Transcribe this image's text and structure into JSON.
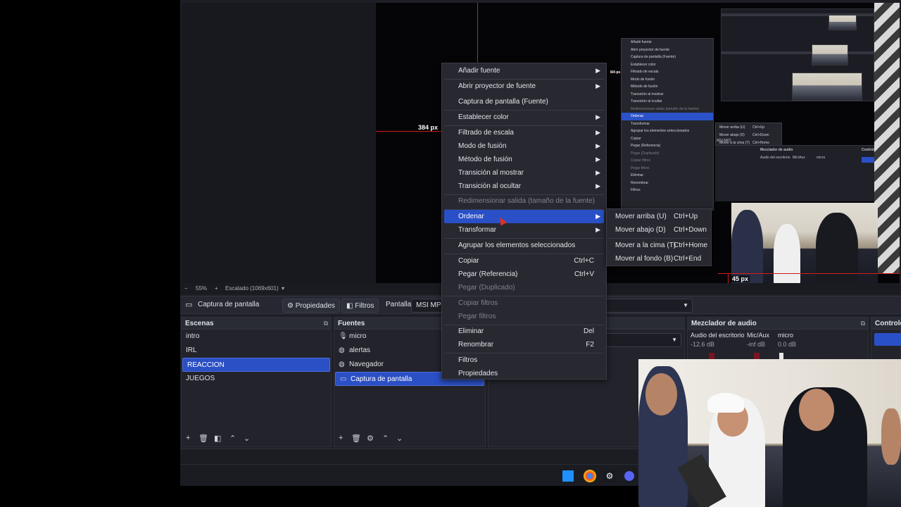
{
  "preview": {
    "px_top_left": "384 px",
    "px_right_small": "8/4 px",
    "px_bottom_right": "45 px"
  },
  "zoombar": {
    "minus": "−",
    "zoom": "55%",
    "plus": "+",
    "scaling": "Escalado (1069x601)",
    "dropdown": "▾"
  },
  "source_toolbar": {
    "source_name": "Captura de pantalla",
    "properties_label": "Propiedades",
    "filters_label": "Filtros",
    "screen_label": "Pantalla",
    "screen_value": "MSI MP2"
  },
  "scenes": {
    "header": "Escenas",
    "items": [
      {
        "label": "intro",
        "selected": false
      },
      {
        "label": "IRL",
        "selected": false
      },
      {
        "label": "REACCION",
        "selected": true
      },
      {
        "label": "JUEGOS",
        "selected": false
      }
    ]
  },
  "sources": {
    "header": "Fuentes",
    "items": [
      {
        "label": "micro",
        "icon": "microphone-icon"
      },
      {
        "label": "alertas",
        "icon": "globe-icon"
      },
      {
        "label": "Navegador",
        "icon": "globe-icon"
      },
      {
        "label": "Captura de pantalla",
        "icon": "monitor-icon",
        "selected": true
      }
    ]
  },
  "mixer": {
    "header": "Mezclador de audio",
    "channels": [
      {
        "name": "Audio del escritorio",
        "level": "-12.6 dB"
      },
      {
        "name": "Mic/Aux",
        "level": "-inf dB"
      },
      {
        "name": "micro",
        "level": "0.0 dB"
      }
    ]
  },
  "controls": {
    "header": "Controles"
  },
  "context_menu": {
    "items": {
      "add_source": "Añadir fuente",
      "open_projector": "Abrir proyector de fuente",
      "screenshot_source": "Captura de pantalla (Fuente)",
      "set_color": "Establecer color",
      "scale_filter": "Filtrado de escala",
      "blend_mode": "Modo de fusión",
      "blend_method": "Método de fusión",
      "show_transition": "Transición al mostrar",
      "hide_transition": "Transición al ocultar",
      "resize_output": "Redimensionar salida (tamaño de la fuente)",
      "order": "Ordenar",
      "transform": "Transformar",
      "group_selected": "Agrupar los elementos seleccionados",
      "copy": "Copiar",
      "copy_sc": "Ctrl+C",
      "paste_ref": "Pegar (Referencia)",
      "paste_ref_sc": "Ctrl+V",
      "paste_dup": "Pegar (Duplicado)",
      "copy_filters": "Copiar filtros",
      "paste_filters": "Pegar filtros",
      "delete": "Eliminar",
      "delete_sc": "Del",
      "rename": "Renombrar",
      "rename_sc": "F2",
      "filters": "Filtros",
      "properties": "Propiedades"
    }
  },
  "order_submenu": {
    "items": [
      {
        "label": "Mover arriba (U)",
        "shortcut": "Ctrl+Up"
      },
      {
        "label": "Mover abajo (D)",
        "shortcut": "Ctrl+Down"
      },
      {
        "label": "Mover a la cima (T)",
        "shortcut": "Ctrl+Home"
      },
      {
        "label": "Mover al fondo (B)",
        "shortcut": "Ctrl+End"
      }
    ]
  },
  "mini_menu": {
    "items": [
      "Añadir fuente",
      "Abrir proyector de fuente",
      "Captura de pantalla (Fuente)",
      "Establecer color",
      "Filtrado de escala",
      "Modo de fusión",
      "Método de fusión",
      "Transición al mostrar",
      "Transición al ocultar",
      "Redimensionar salida (tamaño de la fuente)",
      "Ordenar",
      "Transformar",
      "Agrupar los elementos seleccionados",
      "Copiar",
      "Pegar (Referencia)",
      "Pegar (Duplicado)",
      "Copiar filtros",
      "Pegar filtros",
      "Eliminar",
      "Renombrar",
      "Filtros"
    ],
    "shortcuts": {
      "copy": "Ctrl+C",
      "paste": "Ctrl+V",
      "delete": "Del",
      "rename": "F2"
    },
    "sub": [
      "Mover arriba (U)",
      "Mover abajo (D)",
      "Mover a la cima (T)",
      "Mover al fondo (B)"
    ],
    "sub_sc": [
      "Ctrl+Up",
      "Ctrl+Down",
      "Ctrl+Home",
      "Ctrl+End"
    ],
    "mixer_header": "Mezclador de audio",
    "mixer_ch1": "Audio del escritorio",
    "mixer_ch2": "Mic/Aux",
    "mixer_ch3": "micro",
    "controls": "Controle",
    "screen": "MSI MP2"
  },
  "colors": {
    "accent": "#2a50c8",
    "guide": "#d21b1b",
    "panel": "#22232b"
  }
}
